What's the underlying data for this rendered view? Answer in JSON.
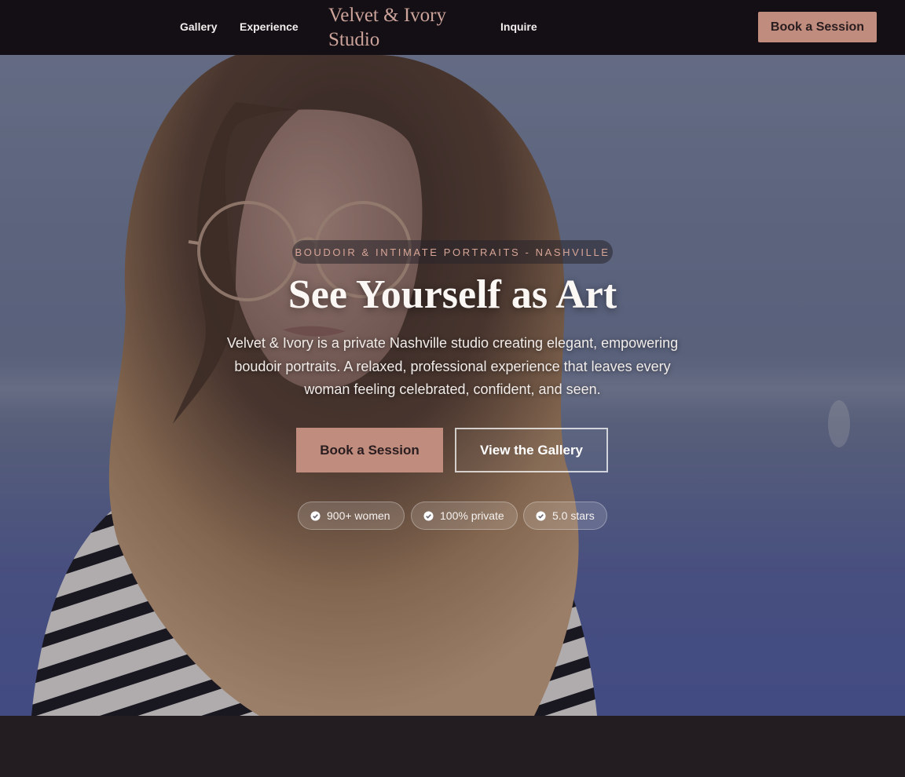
{
  "nav": {
    "links": [
      {
        "label": "Gallery"
      },
      {
        "label": "Experience"
      },
      {
        "label": "Inquire"
      }
    ],
    "brand": "Velvet & Ivory Studio",
    "cta_label": "Book a Session"
  },
  "hero": {
    "eyebrow": "BOUDOIR & INTIMATE PORTRAITS - NASHVILLE",
    "headline": "See Yourself as Art",
    "subtext": "Velvet & Ivory is a private Nashville studio creating elegant, empowering boudoir portraits. A relaxed, professional experience that leaves every woman feeling celebrated, confident, and seen.",
    "primary_cta": "Book a Session",
    "secondary_cta": "View the Gallery",
    "badges": [
      {
        "label": "900+ women",
        "icon": "check-circle-icon"
      },
      {
        "label": "100% private",
        "icon": "check-circle-icon"
      },
      {
        "label": "5.0 stars",
        "icon": "check-circle-icon"
      }
    ]
  },
  "colors": {
    "nav_bg": "#140f14",
    "accent": "#c08c7d",
    "brand_text": "#cba39a",
    "eyebrow_text": "#d7a596",
    "page_bg": "#231d22"
  }
}
